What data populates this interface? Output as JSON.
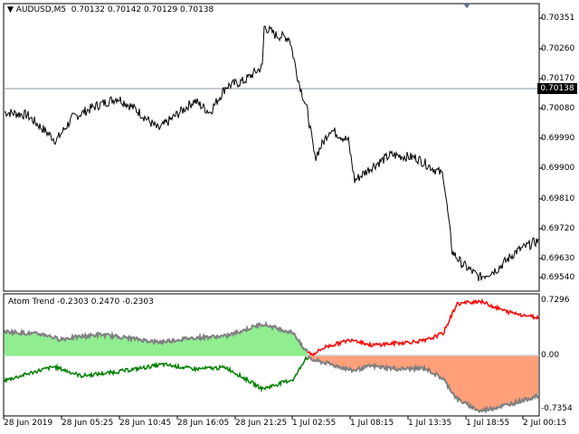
{
  "main_panel": {
    "symbol_header": "AUDUSD,M5",
    "ohlc": "0.70132 0.70142 0.70129 0.70138",
    "y_labels": [
      "0.70351",
      "0.70260",
      "0.70170",
      "0.70080",
      "0.69990",
      "0.69900",
      "0.69810",
      "0.69720",
      "0.69630",
      "0.69540"
    ],
    "current_price": "0.70138"
  },
  "indicator_panel": {
    "name": "Atom Trend",
    "values": "-0.2303 0.2470 -0.2303",
    "y_labels": [
      "0.7296",
      "0.00",
      "-0.7354"
    ],
    "colors": {
      "bull_fill": "#90ee90",
      "bull_line": "#008000",
      "bear_fill": "#ffa07a",
      "bear_line": "#ff0000",
      "envelope": "#808080"
    }
  },
  "x_axis": {
    "labels": [
      "28 Jun 2019",
      "28 Jun 05:25",
      "28 Jun 10:45",
      "28 Jun 16:05",
      "28 Jun 21:25",
      "1 Jul 02:55",
      "1 Jul 08:15",
      "1 Jul 13:35",
      "1 Jul 18:55",
      "2 Jul 00:15"
    ]
  },
  "chart_data": [
    {
      "type": "line",
      "title": "AUDUSD,M5",
      "ylim": [
        0.695,
        0.7042
      ],
      "x": [
        "28 Jun 2019",
        "28 Jun 05:25",
        "28 Jun 10:45",
        "28 Jun 16:05",
        "28 Jun 21:25",
        "1 Jul 02:55",
        "1 Jul 08:15",
        "1 Jul 13:35",
        "1 Jul 18:55",
        "2 Jul 00:15"
      ],
      "series": [
        {
          "name": "AUDUSD,M5",
          "values": [
            0.7007,
            0.7009,
            0.7011,
            0.7012,
            0.7019,
            0.7004,
            0.6996,
            0.6996,
            0.6957,
            0.6964
          ]
        }
      ],
      "current_price": 0.70138
    },
    {
      "type": "area",
      "title": "Atom Trend",
      "ylim": [
        -0.7354,
        0.7296
      ],
      "x": [
        "28 Jun 2019",
        "28 Jun 05:25",
        "28 Jun 10:45",
        "28 Jun 16:05",
        "28 Jun 21:25",
        "1 Jul 02:55",
        "1 Jul 08:15",
        "1 Jul 13:35",
        "1 Jul 18:55",
        "2 Jul 00:15"
      ],
      "series": [
        {
          "name": "upper",
          "values": [
            0.35,
            0.32,
            0.25,
            0.24,
            0.34,
            0.16,
            0.16,
            0.18,
            0.65,
            0.51
          ]
        },
        {
          "name": "lower",
          "values": [
            -0.35,
            -0.28,
            -0.2,
            -0.21,
            -0.38,
            -0.07,
            -0.22,
            -0.3,
            -0.72,
            -0.55
          ]
        }
      ]
    }
  ]
}
